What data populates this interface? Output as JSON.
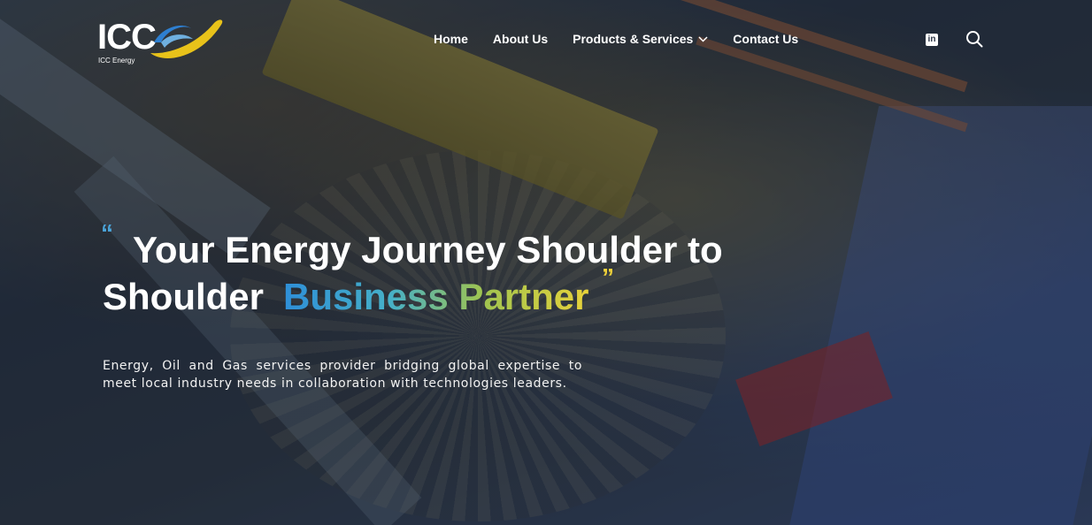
{
  "logo": {
    "text": "ICC",
    "subtitle": "ICC Energy"
  },
  "nav": {
    "items": [
      {
        "label": "Home"
      },
      {
        "label": "About Us"
      },
      {
        "label": "Products & Services",
        "has_dropdown": true
      },
      {
        "label": "Contact Us"
      }
    ]
  },
  "header_icons": {
    "social": "linkedin-icon",
    "search": "search-icon"
  },
  "hero": {
    "quote_open": "“",
    "quote_close": "”",
    "headline_line1": "Your Energy Journey Shoulder to",
    "headline_line2_plain": "Shoulder",
    "headline_line2_highlight": "Business Partner",
    "description": "Energy, Oil and Gas services provider bridging global expertise to meet local industry needs in collaboration with technologies leaders."
  },
  "colors": {
    "accent_blue": "#2e8fd8",
    "accent_green": "#9fc450",
    "accent_yellow": "#e8d23a",
    "text_white": "#ffffff"
  }
}
